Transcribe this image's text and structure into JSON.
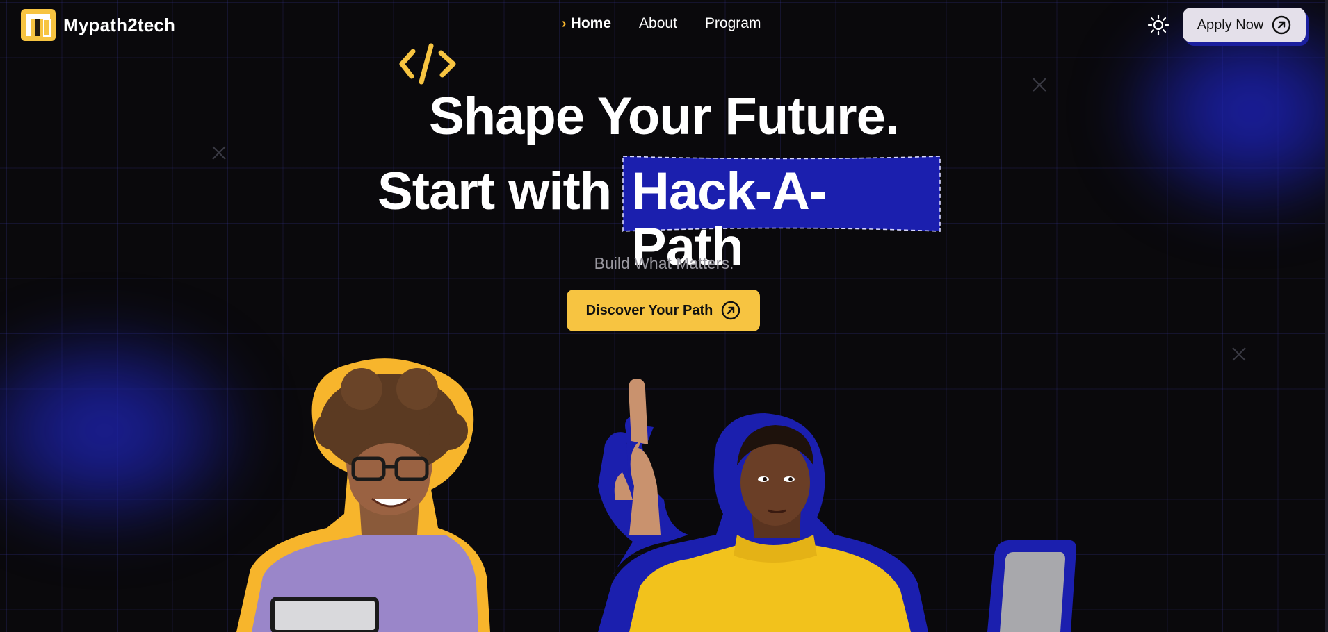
{
  "brand": {
    "name": "Mypath2tech",
    "accent": "#f7c441",
    "blue": "#1b1f9e"
  },
  "nav": {
    "items": [
      {
        "label": "Home",
        "active": true
      },
      {
        "label": "About",
        "active": false
      },
      {
        "label": "Program",
        "active": false
      }
    ]
  },
  "header": {
    "theme_icon": "sun-icon",
    "apply_label": "Apply Now"
  },
  "hero": {
    "line1": "Shape Your Future.",
    "line2_prefix": "Start with",
    "line2_highlight": "Hack-A-Path",
    "subtitle": "Build What Matters.",
    "cta_label": "Discover Your Path"
  }
}
